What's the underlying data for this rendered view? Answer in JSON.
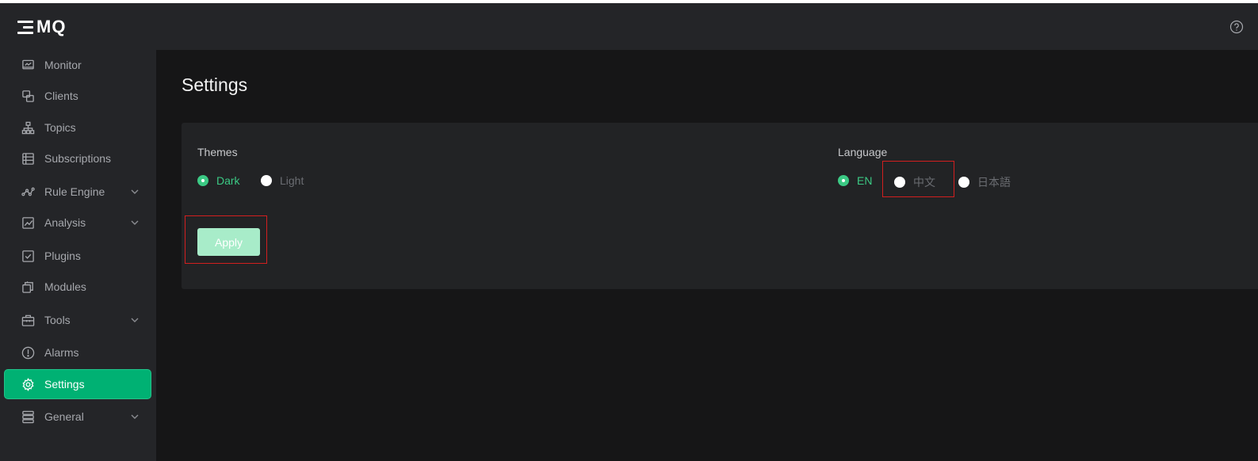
{
  "app": {
    "logo_text": "MQ"
  },
  "sidebar": {
    "items": [
      {
        "label": "Monitor"
      },
      {
        "label": "Clients"
      },
      {
        "label": "Topics"
      },
      {
        "label": "Subscriptions"
      },
      {
        "label": "Rule Engine"
      },
      {
        "label": "Analysis"
      },
      {
        "label": "Plugins"
      },
      {
        "label": "Modules"
      },
      {
        "label": "Tools"
      },
      {
        "label": "Alarms"
      },
      {
        "label": "Settings"
      },
      {
        "label": "General"
      }
    ],
    "active_item": "Settings"
  },
  "header": {
    "help_icon": "question-circle-icon"
  },
  "page": {
    "title": "Settings",
    "themes": {
      "label": "Themes",
      "options": [
        "Dark",
        "Light"
      ],
      "selected": "Dark"
    },
    "language": {
      "label": "Language",
      "options": [
        "EN",
        "中文",
        "日本語"
      ],
      "selected": "EN"
    },
    "apply_label": "Apply"
  },
  "colors": {
    "accent": "#00b173",
    "selected_radio": "#3bc984",
    "apply_button": "#a8ecc9",
    "highlight_border": "#d21f1f",
    "sidebar_bg": "#242528",
    "content_bg": "#161617"
  }
}
